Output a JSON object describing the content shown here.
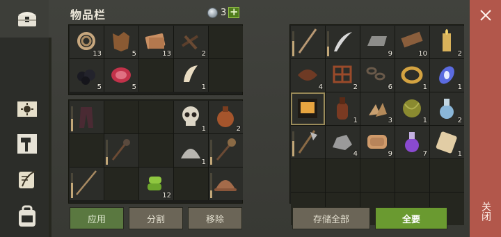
{
  "header": {
    "title": "物品栏",
    "coin_count": "3",
    "add_label": "+"
  },
  "buttons": {
    "apply": "应用",
    "split": "分割",
    "remove": "移除",
    "store_all": "存储全部",
    "take_all": "全要"
  },
  "close": {
    "label": "关闭"
  },
  "left_top": [
    {
      "icon": "rope-icon",
      "qty": "13"
    },
    {
      "icon": "leather-hide-icon",
      "qty": "5"
    },
    {
      "icon": "fabric-scraps-icon",
      "qty": "13"
    },
    {
      "icon": "nails-icon",
      "qty": "2"
    },
    {
      "icon": "",
      "qty": ""
    },
    {
      "icon": "coal-icon",
      "qty": "5"
    },
    {
      "icon": "raw-meat-icon",
      "qty": "5"
    },
    {
      "icon": "",
      "qty": ""
    },
    {
      "icon": "fang-icon",
      "qty": "1"
    },
    {
      "icon": "",
      "qty": ""
    }
  ],
  "left_bottom": [
    {
      "icon": "pants-icon",
      "qty": "",
      "dura": 0.5
    },
    {
      "icon": "",
      "qty": ""
    },
    {
      "icon": "",
      "qty": ""
    },
    {
      "icon": "skull-icon",
      "qty": "1"
    },
    {
      "icon": "flask-icon",
      "qty": "2"
    },
    {
      "icon": "",
      "qty": ""
    },
    {
      "icon": "spiked-club-icon",
      "qty": "",
      "dura": 0.3
    },
    {
      "icon": "",
      "qty": ""
    },
    {
      "icon": "powder-pile-icon",
      "qty": "1"
    },
    {
      "icon": "mace-icon",
      "qty": "",
      "dura": 0.3
    },
    {
      "icon": "spear-icon",
      "qty": "",
      "dura": 0.6
    },
    {
      "icon": "",
      "qty": ""
    },
    {
      "icon": "plant-stems-icon",
      "qty": "12"
    },
    {
      "icon": "",
      "qty": ""
    },
    {
      "icon": "helmet-icon",
      "qty": "",
      "dura": 0.3
    }
  ],
  "right": [
    {
      "icon": "staff-icon",
      "qty": "",
      "dura": 0.6
    },
    {
      "icon": "scimitar-icon",
      "qty": "",
      "dura": 0.4
    },
    {
      "icon": "iron-ingot-icon",
      "qty": "9"
    },
    {
      "icon": "wood-plank-icon",
      "qty": "10"
    },
    {
      "icon": "candle-icon",
      "qty": "2"
    },
    {
      "icon": "leather-strips-icon",
      "qty": "4"
    },
    {
      "icon": "netting-icon",
      "qty": "2"
    },
    {
      "icon": "chain-icon",
      "qty": "6"
    },
    {
      "icon": "gold-ring-icon",
      "qty": "1"
    },
    {
      "icon": "magic-gem-icon",
      "qty": "1"
    },
    {
      "icon": "recipe-book-icon",
      "qty": "",
      "selected": true
    },
    {
      "icon": "leather-flask-icon",
      "qty": "1"
    },
    {
      "icon": "wood-chips-icon",
      "qty": "3"
    },
    {
      "icon": "yarn-ball-icon",
      "qty": "1"
    },
    {
      "icon": "potion-icon",
      "qty": "2"
    },
    {
      "icon": "halberd-icon",
      "qty": "",
      "dura": 0.6
    },
    {
      "icon": "stone-ore-icon",
      "qty": "4"
    },
    {
      "icon": "cloth-roll-icon",
      "qty": "9"
    },
    {
      "icon": "purple-potion-icon",
      "qty": "7"
    },
    {
      "icon": "scroll-bundle-icon",
      "qty": "1"
    },
    {
      "icon": "",
      "qty": ""
    },
    {
      "icon": "",
      "qty": ""
    },
    {
      "icon": "",
      "qty": ""
    },
    {
      "icon": "",
      "qty": ""
    },
    {
      "icon": "",
      "qty": ""
    },
    {
      "icon": "",
      "qty": ""
    },
    {
      "icon": "",
      "qty": ""
    },
    {
      "icon": "",
      "qty": ""
    },
    {
      "icon": "",
      "qty": ""
    },
    {
      "icon": "",
      "qty": ""
    }
  ],
  "sidebar": [
    {
      "icon": "chest-icon"
    },
    {
      "icon": "sun-map-icon"
    },
    {
      "icon": "hammer-icon"
    },
    {
      "icon": "scroll-quill-icon"
    },
    {
      "icon": "backpack-icon"
    }
  ]
}
